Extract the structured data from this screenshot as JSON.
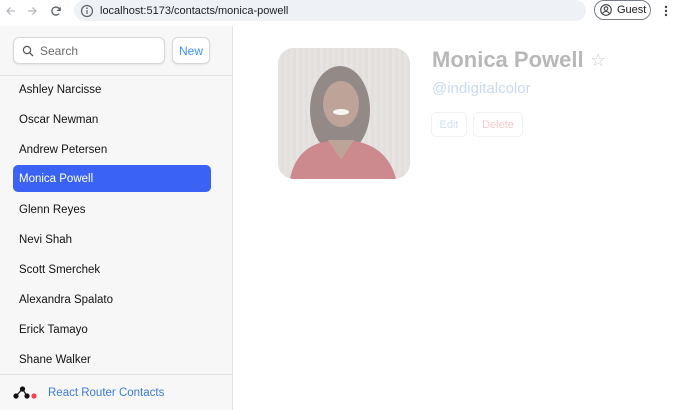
{
  "browser": {
    "url": "localhost:5173/contacts/monica-powell",
    "profile_label": "Guest"
  },
  "sidebar": {
    "search_placeholder": "Search",
    "new_label": "New",
    "contacts": [
      {
        "name": "Ashley Narcisse",
        "active": false
      },
      {
        "name": "Oscar Newman",
        "active": false
      },
      {
        "name": "Andrew Petersen",
        "active": false
      },
      {
        "name": "Monica Powell",
        "active": true
      },
      {
        "name": "Glenn Reyes",
        "active": false
      },
      {
        "name": "Nevi Shah",
        "active": false
      },
      {
        "name": "Scott Smerchek",
        "active": false
      },
      {
        "name": "Alexandra Spalato",
        "active": false
      },
      {
        "name": "Erick Tamayo",
        "active": false
      },
      {
        "name": "Shane Walker",
        "active": false
      }
    ],
    "footer_title": "React Router Contacts"
  },
  "detail": {
    "name": "Monica Powell",
    "handle": "@indigitalcolor",
    "favorite_icon": "☆",
    "edit_label": "Edit",
    "delete_label": "Delete"
  },
  "colors": {
    "accent": "#3a63f5",
    "link": "#3992ff",
    "delete": "#f44250"
  }
}
